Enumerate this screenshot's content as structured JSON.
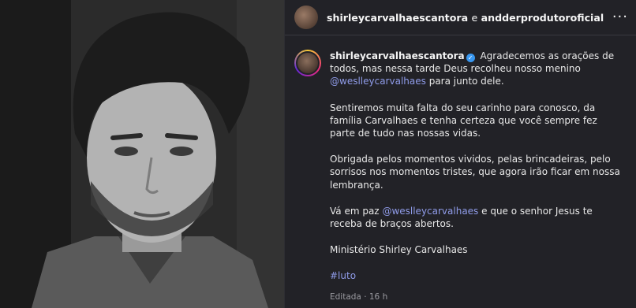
{
  "header": {
    "user1": "shirleycarvalhaescantora",
    "conj": "e",
    "user2": "andderprodutoroficial",
    "more": "···"
  },
  "post": {
    "username": "shirleycarvalhaescantora",
    "p1_a": "Agradecemos as orações de todos, mas nessa tarde Deus recolheu nosso menino",
    "p1_mention": "@weslleycarvalhaes",
    "p1_b": "para junto dele.",
    "p2": "Sentiremos muita falta do seu carinho para conosco, da família Carvalhaes e tenha certeza que você sempre fez parte de tudo nas nossas vidas.",
    "p3": "Obrigada pelos momentos vividos, pelas brincadeiras, pelo sorrisos nos momentos tristes, que agora irão ficar em nossa lembrança.",
    "p4_a": "Vá em paz",
    "p4_mention": "@weslleycarvalhaes",
    "p4_b": "e que o senhor Jesus te receba de braços abertos.",
    "p5": "Ministério Shirley Carvalhaes",
    "hashtag": "#luto",
    "meta": "Editada · 16 h"
  },
  "colors": {
    "panel_bg": "#222227",
    "mention": "#8f9be8",
    "verified": "#3897f0"
  }
}
